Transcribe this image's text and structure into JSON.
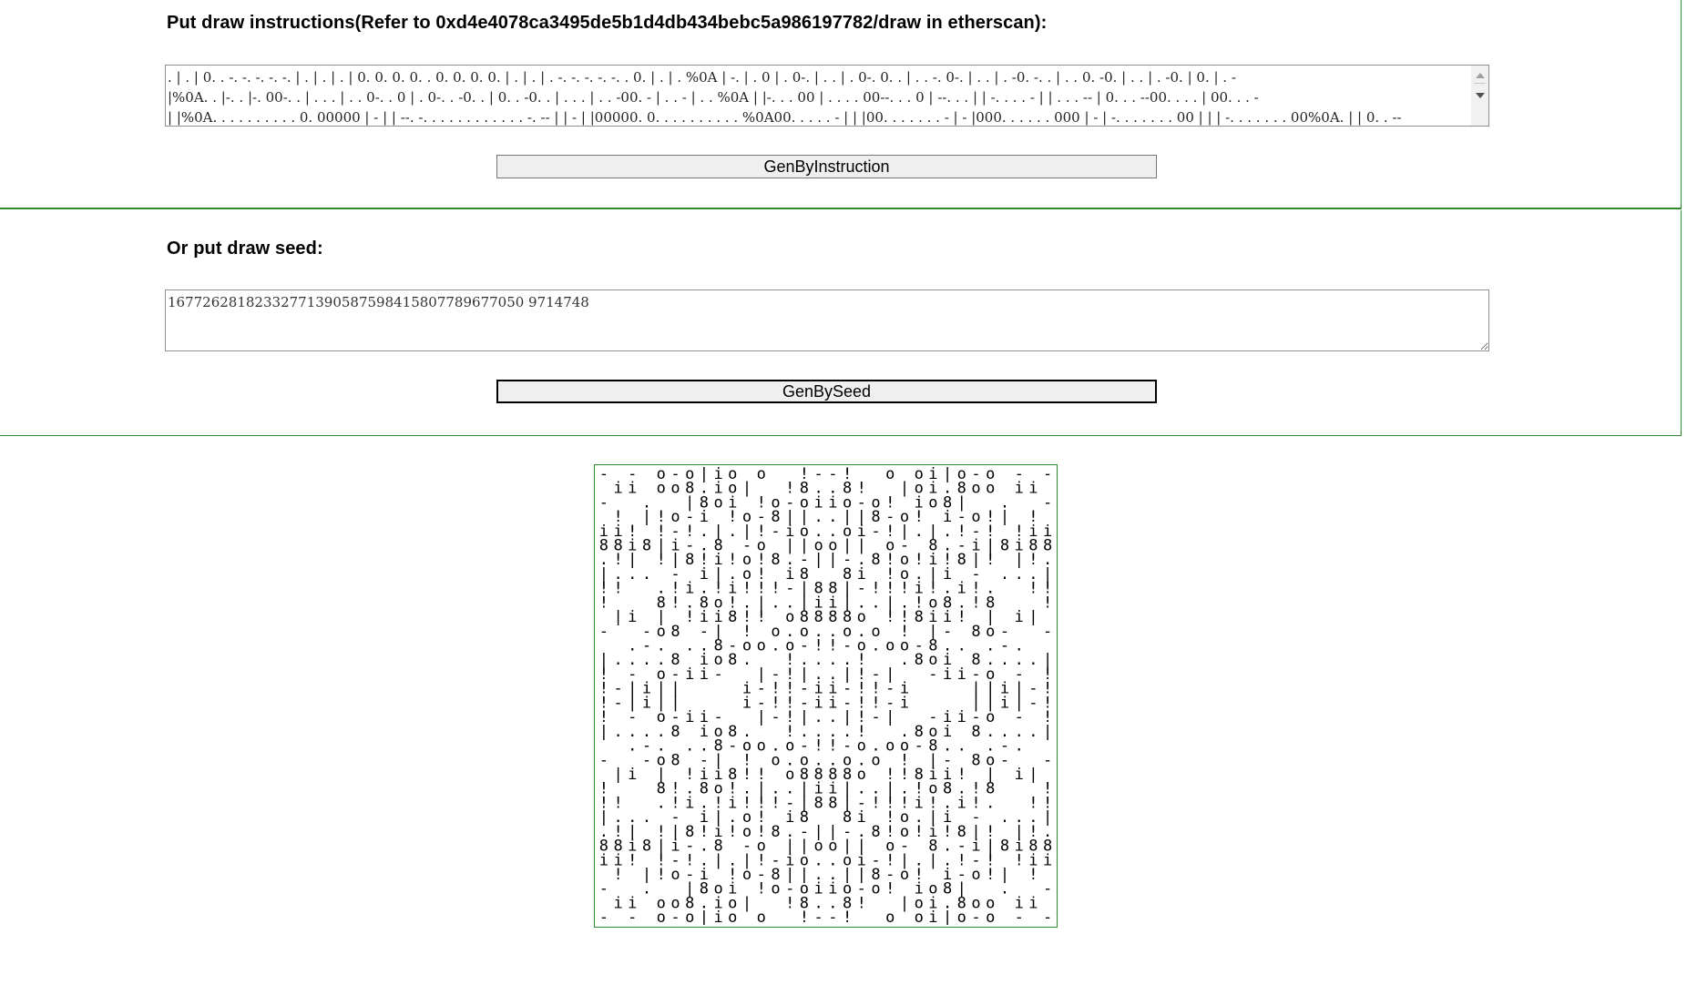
{
  "instructions_section": {
    "heading": "Put draw instructions(Refer to 0xd4e4078ca3495de5b1d4db434bebc5a986197782/draw in etherscan):",
    "textarea_value": ". | . | 0. . -. -. -. -. -. | . | . | . | 0. 0. 0. 0. . 0. 0. 0. 0. | . | . | . -. -. -. -. -. . 0. | . | . %0A | -. | . 0 | . 0-. | . . | . 0-. 0. . | . . -. 0-. | . . | . -0. -. . | . . 0. -0. | . . | . -0. | 0. | . -\n|%0A. . |-. . |-. 00-. . | . . . | . . 0-. . 0 | . 0-. . -0. . | 0. . -0. . | . . . | . . -00. - | . . - | . . %0A | |-. . . 00 | . . . . 00--. . . 0 | --. . . | | -. . . . - | | . . . -- | 0. . . --00. . . . | 00. . . -\n| |%0A. . . . . . . . . . 0. 00000 | - | | --. -. . . . . . . . . . . . -. -- | | - | |00000. 0. . . . . . . . . . %0A00. . . . . - | | |00. . . . . . . - | - |000. . . . . . 000 | - | -. . . . . . . 00 | | | -. . . . . . . 00%0A. | | 0. . --",
    "button_label": "GenByInstruction"
  },
  "seed_section": {
    "heading": "Or put draw seed:",
    "textarea_value": "16772628182332771390587598415807789677050 9714748",
    "button_label": "GenBySeed"
  },
  "drawing": {
    "glyph_set": [
      "|",
      "o",
      "8",
      "-",
      ".",
      "!",
      "i"
    ],
    "ink_color": "#000000",
    "frame_color": "#2e8b2e"
  }
}
